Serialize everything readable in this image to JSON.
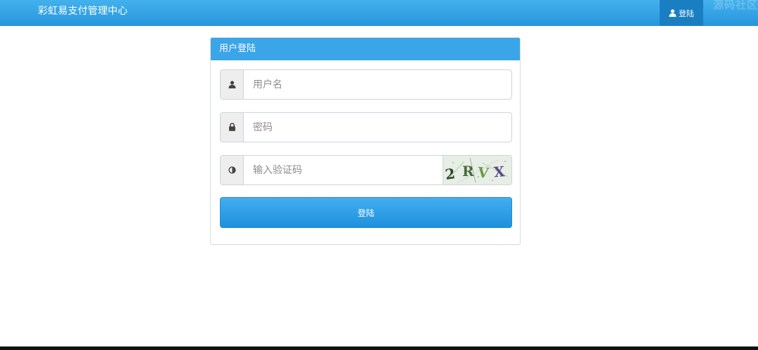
{
  "navbar": {
    "brand": "彩虹易支付管理中心",
    "login_label": "登陆",
    "login_icon": "user-icon",
    "watermark": "源码社区",
    "background": "#2f9fe3",
    "active_background": "#1a7fc2"
  },
  "panel": {
    "title": "用户登陆",
    "heading_color": "#3aa5e8"
  },
  "form": {
    "username": {
      "icon": "user-icon",
      "placeholder": "用户名",
      "value": ""
    },
    "password": {
      "icon": "lock-icon",
      "placeholder": "密码",
      "value": ""
    },
    "captcha": {
      "icon": "contrast-icon",
      "placeholder": "输入验证码",
      "value": "",
      "image_text": "2RVX"
    },
    "submit_label": "登陆"
  }
}
